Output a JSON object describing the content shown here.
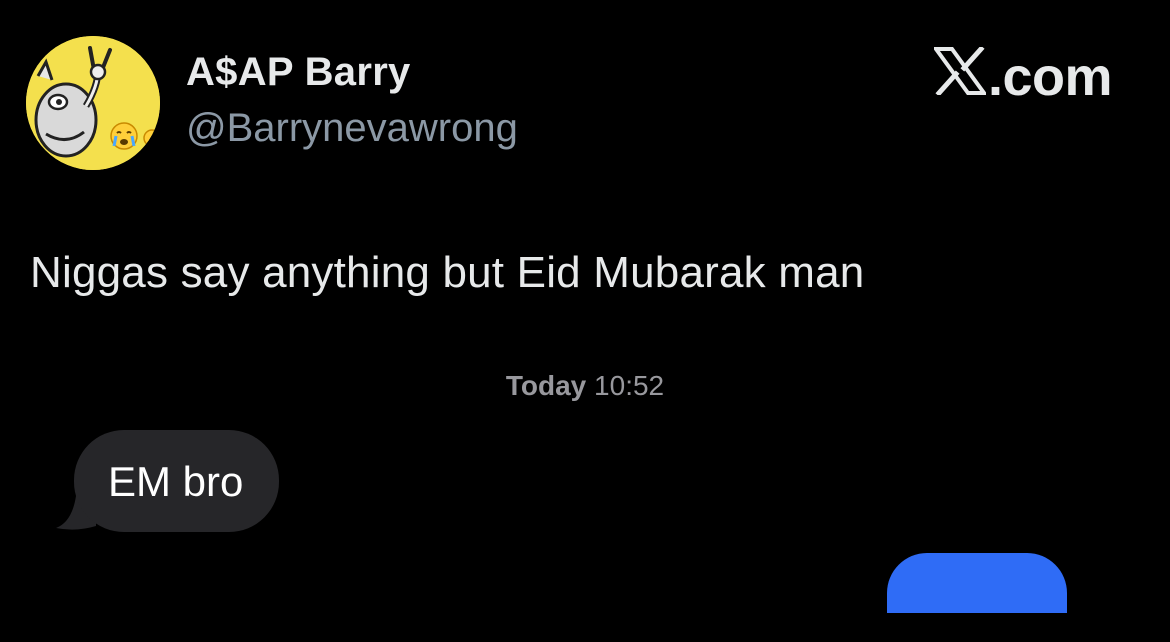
{
  "tweet": {
    "display_name": "A$AP Barry",
    "handle": "@Barrynevawrong",
    "site": "com",
    "site_icon": "x-logo-icon",
    "text": "Niggas say anything but Eid Mubarak man"
  },
  "conversation": {
    "timestamp_day": "Today",
    "timestamp_time": "10:52",
    "messages": [
      {
        "direction": "incoming",
        "text": "EM bro"
      }
    ],
    "outgoing_partial": true
  },
  "colors": {
    "background": "#000000",
    "avatar_bg": "#f4e04d",
    "incoming_bubble": "#262629",
    "outgoing_bubble": "#2f6cf6"
  }
}
